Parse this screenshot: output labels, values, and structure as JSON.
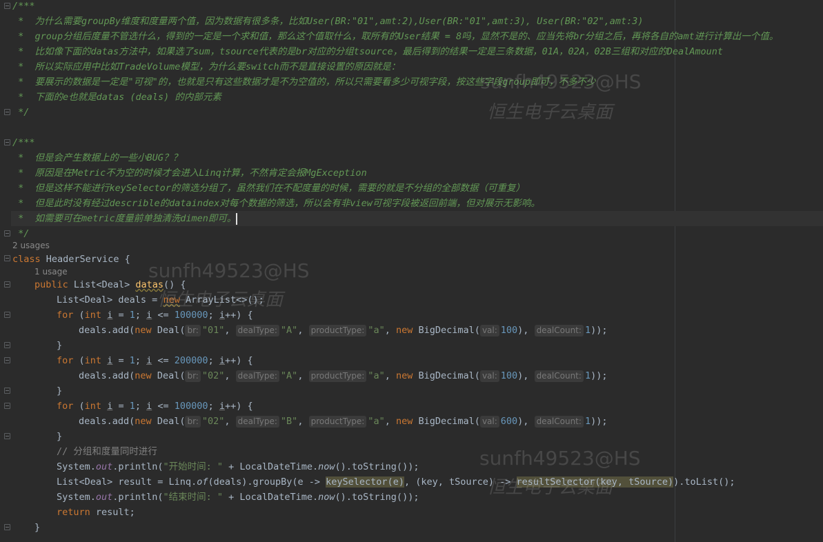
{
  "comment1": {
    "open": "/***",
    "lines": [
      " *  为什么需要groupBy维度和度量两个值，因为数据有很多条，比如User(BR:\"01\",amt:2),User(BR:\"01\",amt:3), User(BR:\"02\",amt:3)",
      " *  group分组后度量不管选什么，得到的一定是一个求和值，那么这个值取什么，取所有的User结果 = 8吗，显然不是的、应当先将br分组之后，再将各自的amt进行计算出一个值。",
      " *  比如像下面的datas方法中，如果选了sum，tsource代表的是br对应的分组tsource，最后得到的结果一定是三条数据，01A，02A，02B三组和对应的DealAmount",
      " *  所以实际应用中比如TradeVolume模型，为什么要switch而不是直接设置的原因就是：",
      " *  要展示的数据是一定是\"可视\"的，也就是只有这些数据才是不为空值的，所以只需要看多少可视字段，按这些字段group即可，不多不少",
      " *  下面的e也就是datas (deals) 的内部元素"
    ],
    "close": " */"
  },
  "comment2": {
    "open": "/***",
    "lines": [
      " *  但是会产生数据上的一些小BUG？？",
      " *  原因是在Metric不为空的时候才会进入Linq计算，不然肯定会报MgException",
      " *  但是这样不能进行keySelector的筛选分组了，虽然我们在不配度量的时候，需要的就是不分组的全部数据（可重复）",
      " *  但是此时没有经过describle的dataindex对每个数据的筛选，所以会有非view可视字段被返回前端，但对展示无影响。",
      " *  如需要可在metric度量前单独清洗dimen即可。"
    ],
    "close": " */"
  },
  "usages": {
    "class_usages": "2 usages",
    "method_usages": "1 usage"
  },
  "code": {
    "class_kw": "class",
    "class_name": "HeaderService",
    "open_brace": " {",
    "public_kw": "public",
    "return_type": "List<Deal>",
    "method_name": "datas",
    "method_sig_tail": "() {",
    "deals_type": "List<Deal> deals = ",
    "new_kw": "new",
    "arraylist": " ArrayList<>();",
    "for_kw": "for",
    "int_kw": "int",
    "loop_var": "i",
    "loop1_limit": "100000",
    "loop2_limit": "200000",
    "loop3_limit": "100000",
    "one": "1",
    "close_brace": "}",
    "deals_add": "deals.add(",
    "deal_ctor": "Deal(",
    "bigdecimal": "BigDecimal(",
    "hint_br": "br:",
    "hint_dealtype": "dealType:",
    "hint_producttype": "productType:",
    "hint_val": "val:",
    "hint_dealcount": "dealCount:",
    "row1": {
      "br": "\"01\"",
      "dealType": "\"A\"",
      "productType": "\"a\"",
      "val": "100",
      "dealCount": "1"
    },
    "row2": {
      "br": "\"02\"",
      "dealType": "\"A\"",
      "productType": "\"a\"",
      "val": "100",
      "dealCount": "1"
    },
    "row3": {
      "br": "\"02\"",
      "dealType": "\"B\"",
      "productType": "\"a\"",
      "val": "600",
      "dealCount": "1"
    },
    "line_comment": "// 分组和度量同时进行",
    "system": "System.",
    "out": "out",
    "println": ".println(",
    "start_str": "\"开始时间: \"",
    "end_str": "\"结束时间: \"",
    "plus_ldt": " + LocalDateTime.",
    "now": "now",
    "tostring_tail": "().toString());",
    "result_decl": "List<Deal> result = Linq.",
    "of": "of",
    "group_by_mid": "(deals).groupBy(e -> ",
    "key_selector": "keySelector(e)",
    "result_mid": ", (key, tSource) -> ",
    "result_selector": "resultSelector(key, tSource)",
    "to_list": ").toList();",
    "return_kw": "return",
    "return_tail": " result;"
  },
  "watermarks": {
    "id": "sunfh49523@HS",
    "desktop": "恒生电子云桌面"
  }
}
